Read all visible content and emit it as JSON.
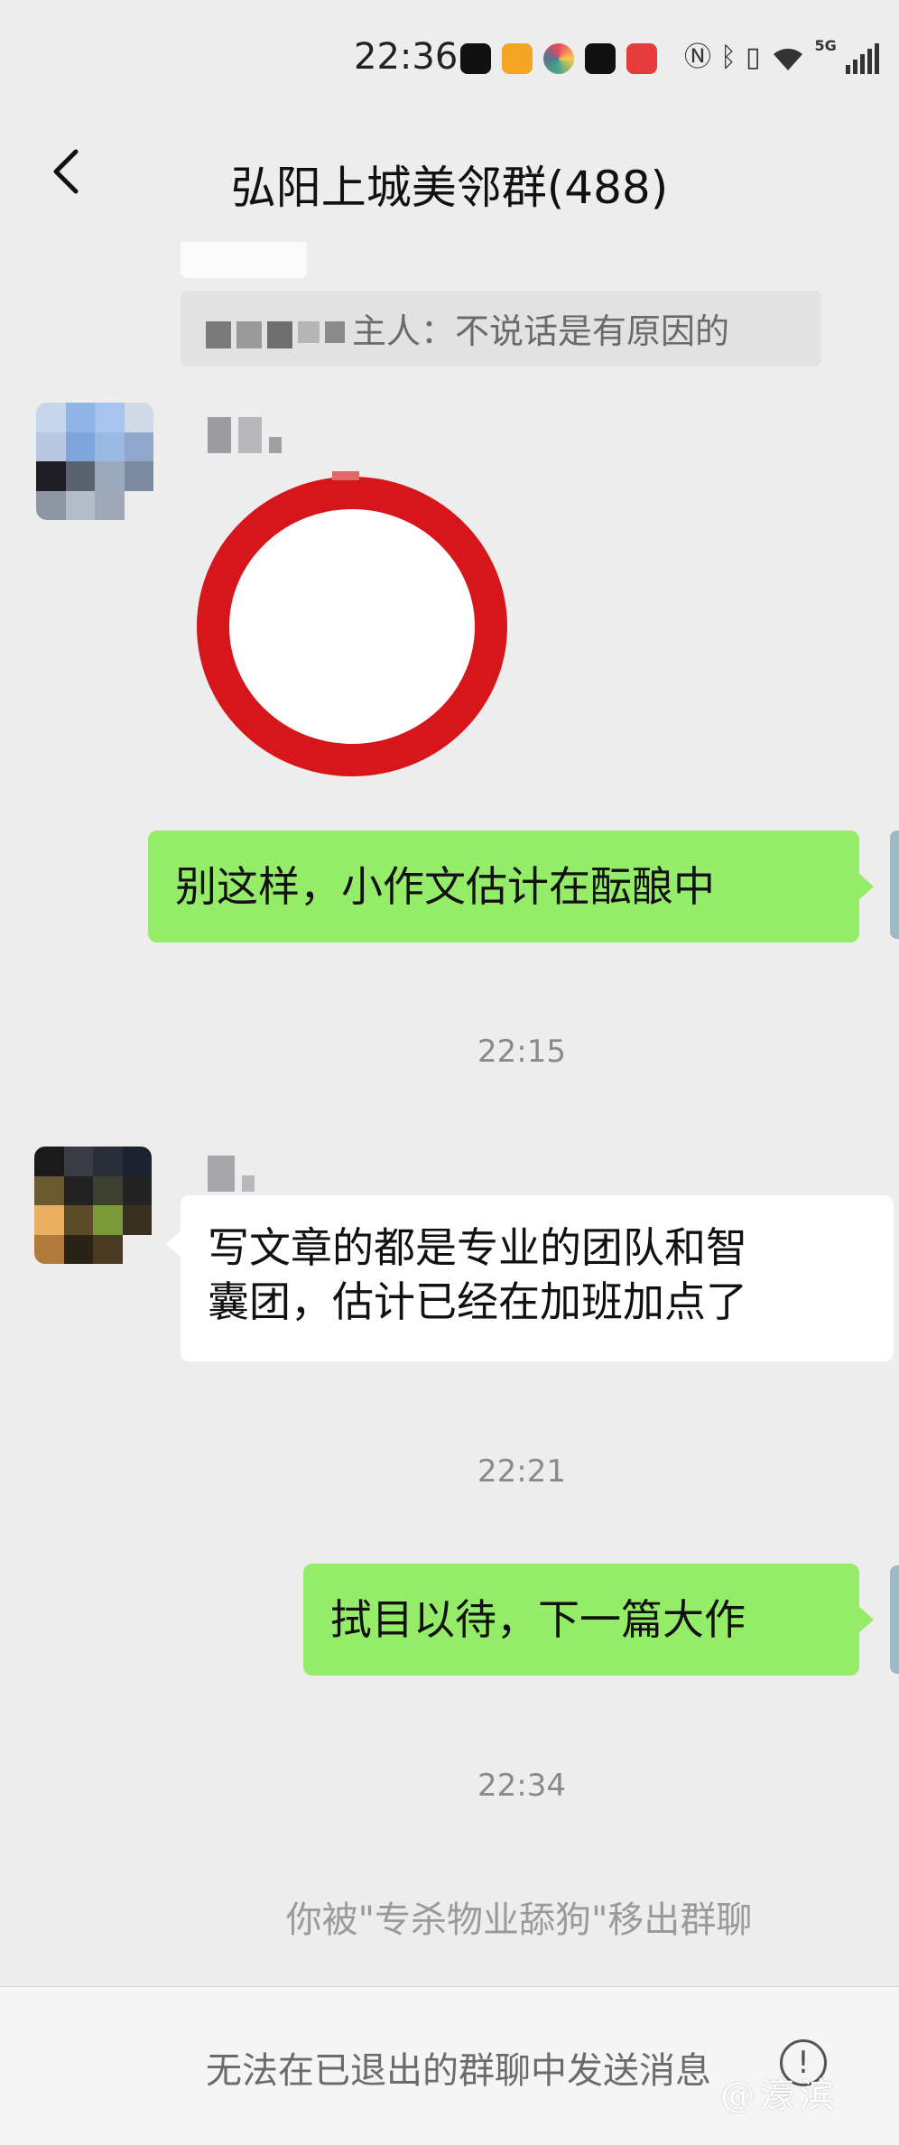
{
  "status_bar": {
    "time": "22:36",
    "network": "5G"
  },
  "header": {
    "title": "弘阳上城美邻群(488)"
  },
  "messages": {
    "quote_text": "主人：不说话是有原因的",
    "msg1": "别这样，小作文估计在酝酿中",
    "time1": "22:15",
    "msg2_line1": "写文章的都是专业的团队和智",
    "msg2_line2": "囊团，估计已经在加班加点了",
    "time2": "22:21",
    "msg3": "拭目以待，下一篇大作",
    "time3": "22:34",
    "system_notice": "你被\"专杀物业舔狗\"移出群聊"
  },
  "bottom_bar": {
    "text": "无法在已退出的群聊中发送消息"
  },
  "watermark": "@濠滨",
  "colors": {
    "background": "#ededed",
    "my_bubble": "#95ec69",
    "other_bubble": "#ffffff",
    "sticker_red": "#d6161a"
  }
}
